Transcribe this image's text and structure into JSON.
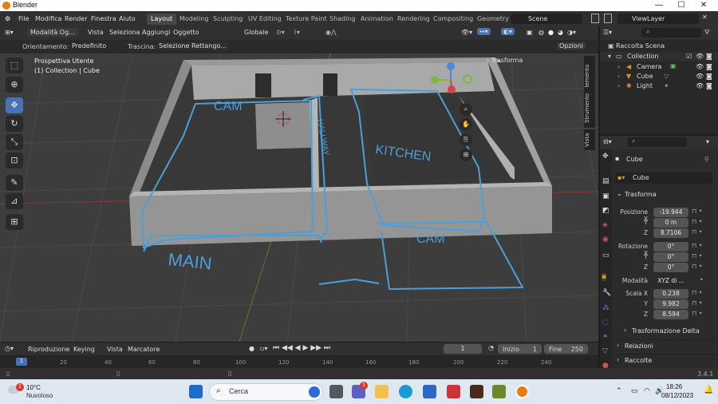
{
  "window": {
    "title": "Blender",
    "min": "—",
    "max": "☐",
    "close": "✕"
  },
  "menu": {
    "items": [
      "File",
      "Modifica",
      "Render",
      "Finestra",
      "Aiuto"
    ]
  },
  "workspaces": [
    "Layout",
    "Modeling",
    "Sculpting",
    "UV Editing",
    "Texture Paint",
    "Shading",
    "Animation",
    "Rendering",
    "Compositing",
    "Geometry"
  ],
  "scene": {
    "name": "Scene",
    "view_layer": "ViewLayer"
  },
  "viewport_header": {
    "mode": "Modalità Og...",
    "menus": [
      "Vista",
      "Seleziona",
      "Aggiungi",
      "Oggetto"
    ],
    "transform": "Globale",
    "orient_label": "Orientamento:",
    "orient_value": "Predefinito",
    "drag_label": "Trascina:",
    "drag_value": "Selezione Rettango...",
    "options": "Opzioni"
  },
  "viewport": {
    "info_line1": "Prospettiva Utente",
    "info_line2": "(1) Collection | Cube",
    "sidebar_panel": "Trasforma",
    "tabs": [
      "Elemento",
      "Strumento",
      "Vista"
    ],
    "annotations": [
      "CAM",
      "HALLWAY",
      "KITCHEN",
      "CAM",
      "MAIN"
    ]
  },
  "outliner": {
    "root": "Raccolta Scena",
    "items": [
      {
        "label": "Collection",
        "level": 0
      },
      {
        "label": "Camera",
        "level": 1
      },
      {
        "label": "Cube",
        "level": 1
      },
      {
        "label": "Light",
        "level": 1
      }
    ]
  },
  "properties": {
    "object": "Cube",
    "data_name": "Cube",
    "section": "Trasforma",
    "pos_label": "Posizione X",
    "pos": [
      "-19.944",
      "0 m",
      "8.7106"
    ],
    "rot_label": "Rotazione X",
    "rot": [
      "0°",
      "0°",
      "0°"
    ],
    "mode_label": "Modalità",
    "mode_value": "XYZ di ...",
    "scale_label": "Scala X",
    "scale": [
      "0.238",
      "9.982",
      "8.594"
    ],
    "axis_y": "Y",
    "axis_z": "Z",
    "sub_sections": [
      "Trasformazione Delta",
      "Relazioni",
      "Raccolte"
    ]
  },
  "timeline": {
    "menus": [
      "Riproduzione",
      "Keying",
      "Vista",
      "Marcatore"
    ],
    "current_frame": "1",
    "start_label": "Inizio",
    "start": "1",
    "end_label": "Fine",
    "end": "250",
    "ruler_ticks": [
      "1",
      "20",
      "40",
      "60",
      "80",
      "100",
      "120",
      "140",
      "160",
      "180",
      "200",
      "220",
      "240"
    ]
  },
  "status": {
    "version": "3.4.1"
  },
  "taskbar": {
    "weather_temp": "10°C",
    "weather_desc": "Nuvoloso",
    "search": "Cerca",
    "notif": "1",
    "teams_badge": "1",
    "time": "18:26",
    "date": "08/12/2023"
  }
}
